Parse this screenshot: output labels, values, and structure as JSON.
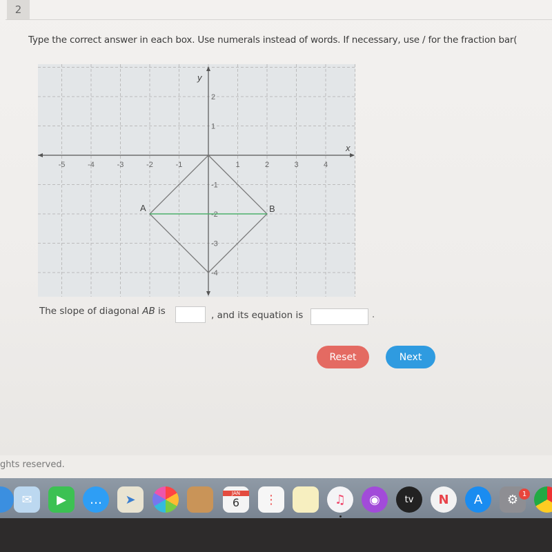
{
  "question_number": "2",
  "instructions": "Type the correct answer in each box. Use numerals instead of words. If necessary, use / for the fraction bar(",
  "graph": {
    "x_axis_label": "x",
    "y_axis_label": "y",
    "x_ticks": [
      "-5",
      "-4",
      "-3",
      "-2",
      "-1",
      "1",
      "2",
      "3",
      "4"
    ],
    "y_ticks": [
      "2",
      "1",
      "-1",
      "-2",
      "-3",
      "-4"
    ],
    "points": [
      {
        "label": "A",
        "x": -2,
        "y": -2
      },
      {
        "label": "B",
        "x": 2,
        "y": -2
      }
    ],
    "square_vertices": [
      [
        0,
        0
      ],
      [
        2,
        -2
      ],
      [
        0,
        -4
      ],
      [
        -2,
        -2
      ]
    ],
    "diagonal_color": "#4caf6a"
  },
  "question": {
    "part1": "The slope of diagonal ",
    "segment": "AB",
    "part2": " is",
    "part3": ", and its equation is",
    "period": ".",
    "slope_value": "",
    "equation_value": ""
  },
  "buttons": {
    "reset": "Reset",
    "next": "Next"
  },
  "footer": {
    "rights": "ghts reserved."
  },
  "dock": {
    "calendar_month": "JAN",
    "calendar_day": "6",
    "tv_label": "tv",
    "settings_badge": "1"
  },
  "colors": {
    "reset": "#e46a62",
    "next": "#2f9be0"
  }
}
